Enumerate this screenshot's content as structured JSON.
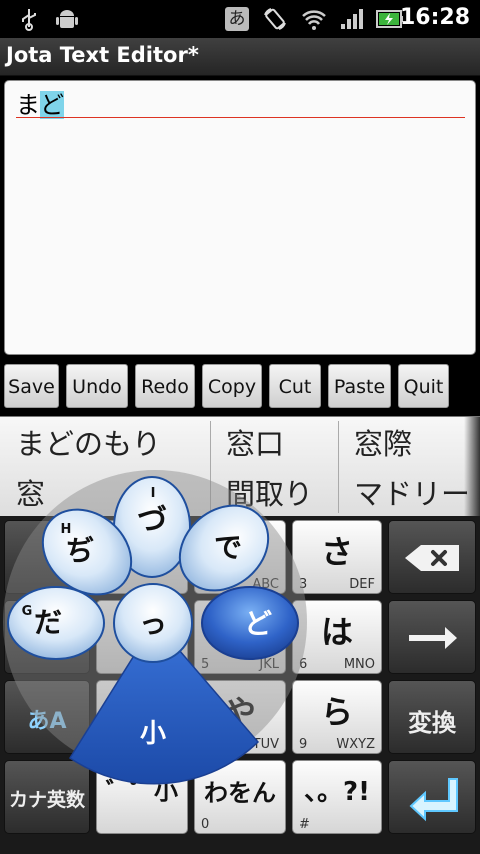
{
  "status_bar": {
    "time": "16:28",
    "ime_indicator": "あ",
    "icons": [
      "usb-icon",
      "android-debug-icon",
      "rotation-icon",
      "wifi-icon",
      "signal-icon",
      "battery-icon"
    ]
  },
  "app": {
    "title": "Jota Text Editor*"
  },
  "editor": {
    "text_committed": "ま",
    "text_composing": "ど"
  },
  "toolbar": {
    "buttons": [
      "Save",
      "Undo",
      "Redo",
      "Copy",
      "Cut",
      "Paste",
      "Quit"
    ]
  },
  "candidates": {
    "row1": [
      "まどのもり",
      "窓口",
      "窓際"
    ],
    "row2": [
      "窓",
      "間取り",
      "マドリー"
    ]
  },
  "keyboard": {
    "keys": {
      "sa": {
        "main": "さ",
        "num": "3",
        "letters": "DEF"
      },
      "ha": {
        "main": "は",
        "num": "6",
        "letters": "MNO"
      },
      "ra": {
        "main": "ら",
        "num": "9",
        "letters": "WXYZ"
      },
      "wa": {
        "main": "わをん",
        "num": "0"
      },
      "punct": {
        "main": "、。?!",
        "num": "#"
      },
      "ma_partial": {
        "num": "5",
        "letters": "JKL"
      },
      "ka_partial": {
        "letters": "ABC"
      },
      "ya_partial": {
        "main": "や",
        "num": "8",
        "letters": "TUV"
      },
      "dakuten": {
        "main": "゛゜小"
      },
      "henkan": {
        "label": "変換"
      },
      "kana_eisu": {
        "label": "カナ英数"
      },
      "mode": {
        "label": "あA"
      }
    },
    "flick_popup": {
      "center": "っ",
      "up": "づ",
      "up_letter": "I",
      "upper_left": "ぢ",
      "upper_left_letter": "H",
      "left": "だ",
      "left_letter": "G",
      "upper_right": "で",
      "right": "ど",
      "down": "小"
    }
  },
  "colors": {
    "accent_blue": "#2f63c8",
    "highlight_cyan": "#7fd4ea",
    "underline_red": "#dd3322"
  }
}
